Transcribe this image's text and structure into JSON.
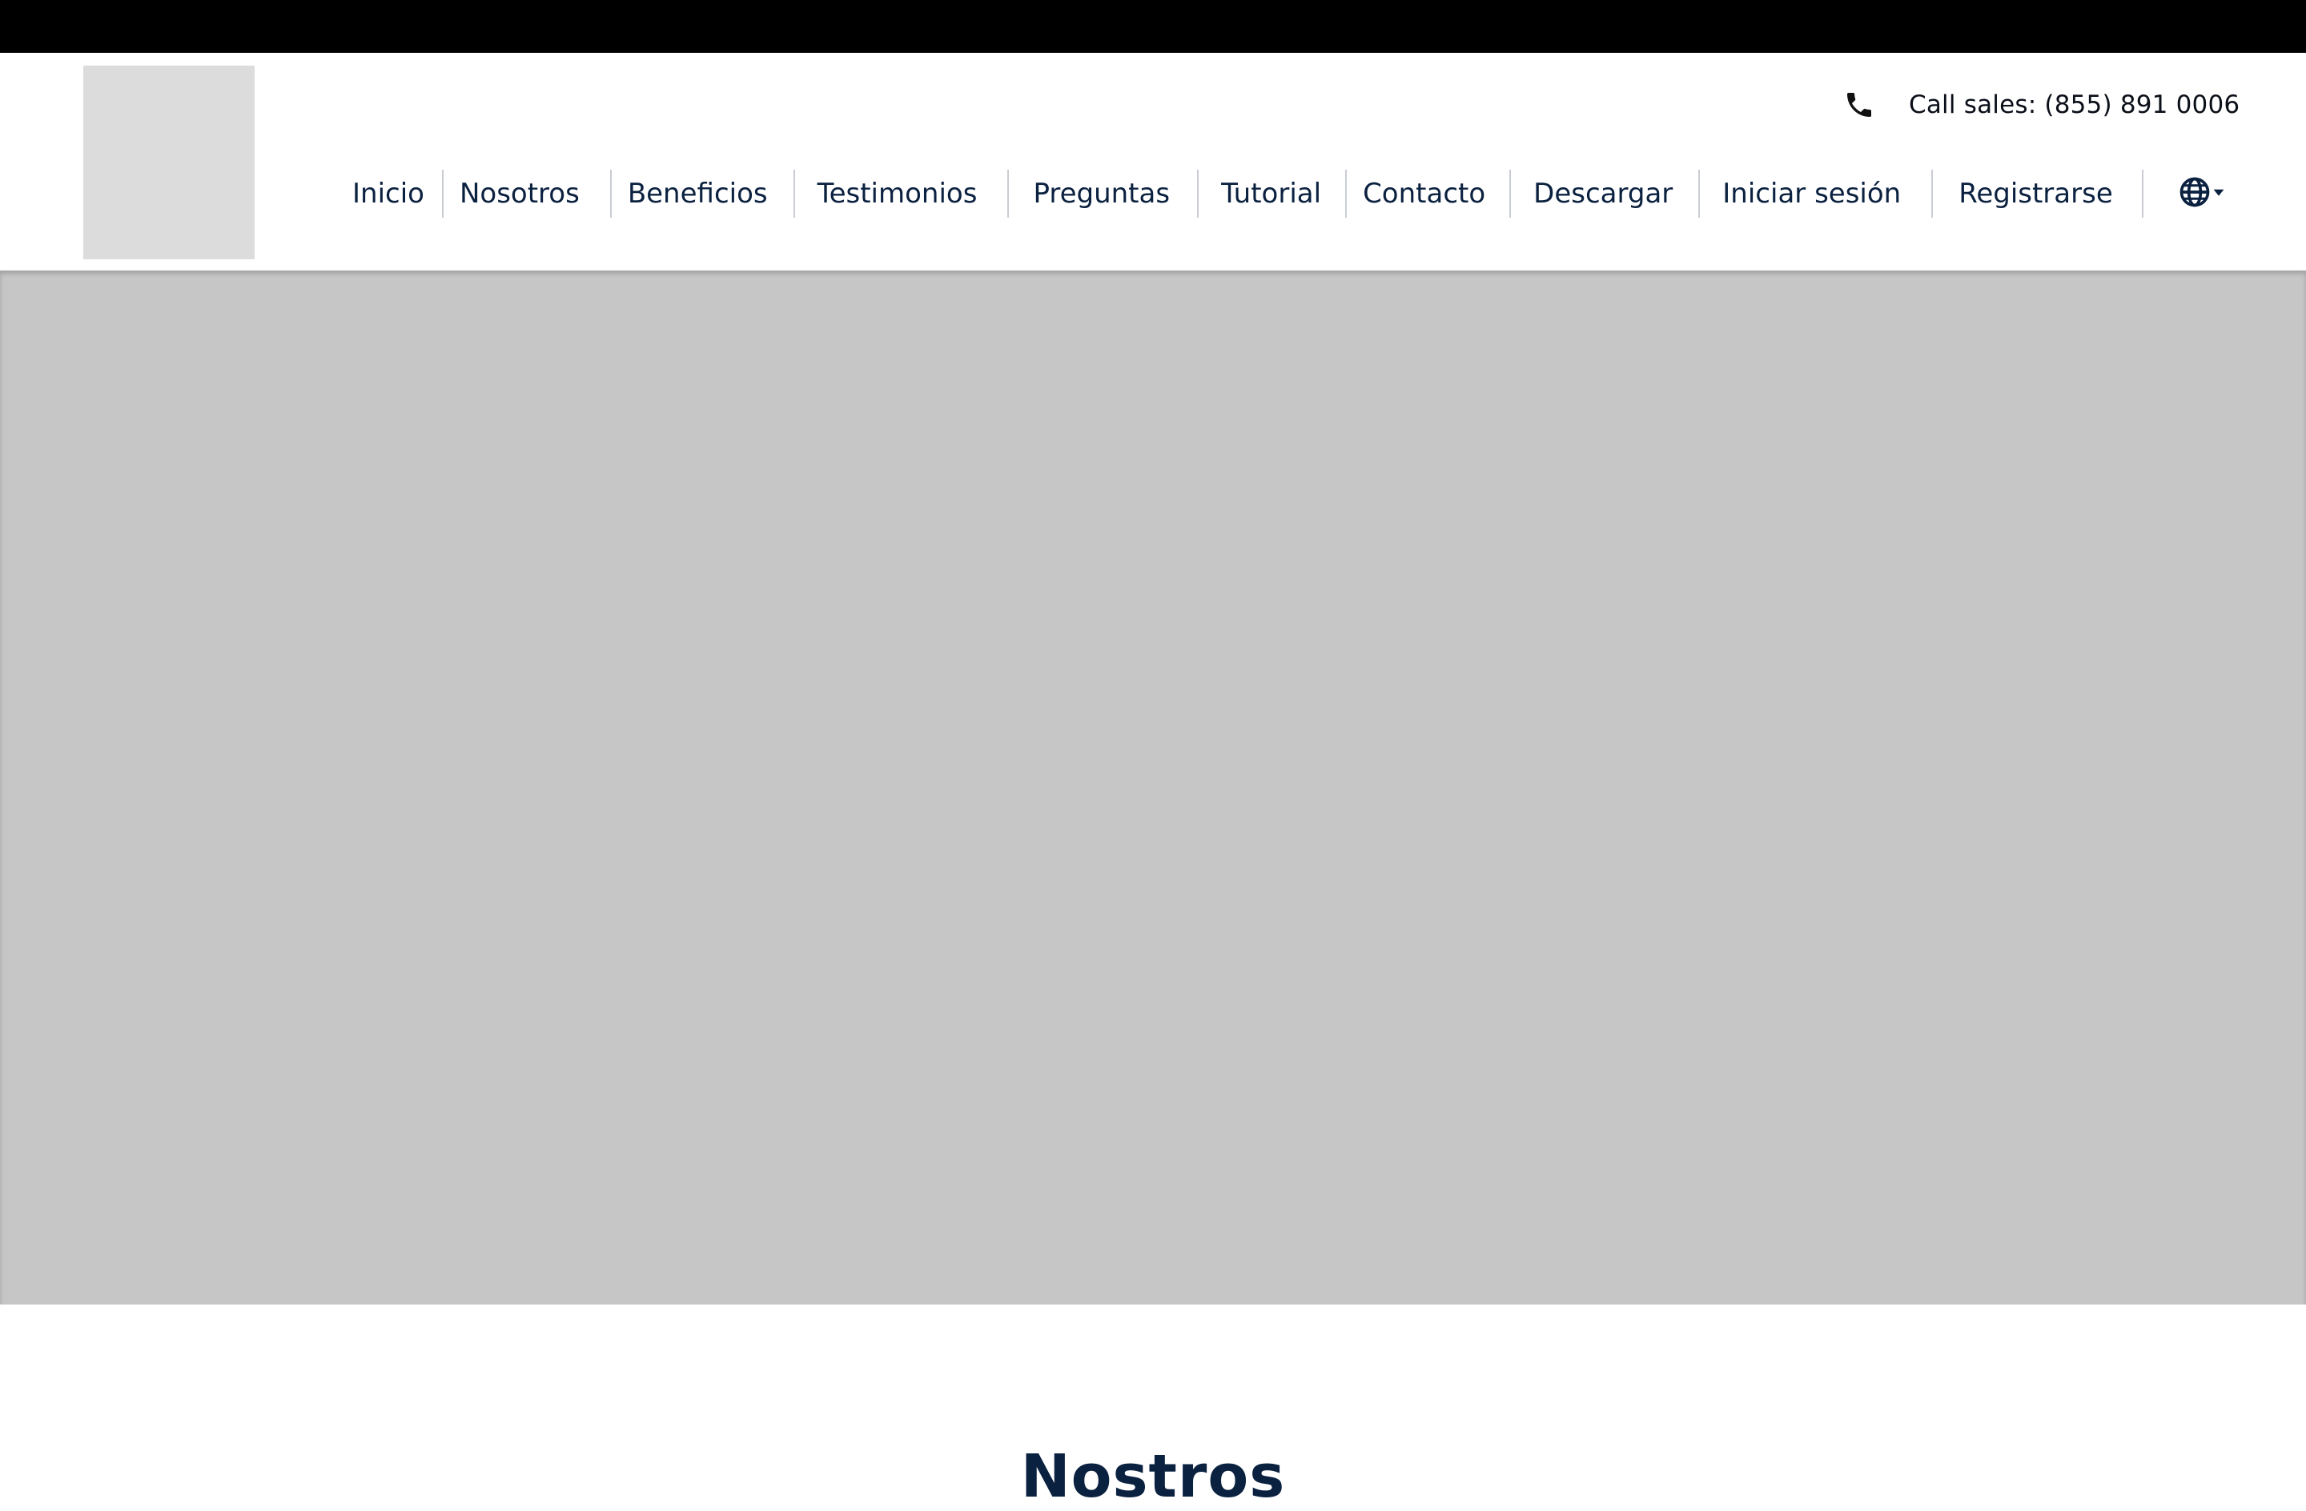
{
  "header": {
    "sales_text": "Call sales: (855) 891 0006",
    "phone_icon": "phone-icon",
    "logo_icon": "logo-placeholder"
  },
  "nav": {
    "items": [
      {
        "label": "Inicio"
      },
      {
        "label": "Nosotros"
      },
      {
        "label": "Beneficios"
      },
      {
        "label": "Testimonios"
      },
      {
        "label": "Preguntas"
      },
      {
        "label": "Tutorial"
      },
      {
        "label": "Contacto"
      },
      {
        "label": "Descargar"
      },
      {
        "label": "Iniciar sesión"
      },
      {
        "label": "Registrarse"
      }
    ],
    "language_icon": "globe-icon"
  },
  "main": {
    "section_title": "Nostros"
  },
  "colors": {
    "nav_text": "#0b2140",
    "topbar": "#000000",
    "hero": "#c6c6c6",
    "logo_placeholder": "#dcdcdc"
  }
}
